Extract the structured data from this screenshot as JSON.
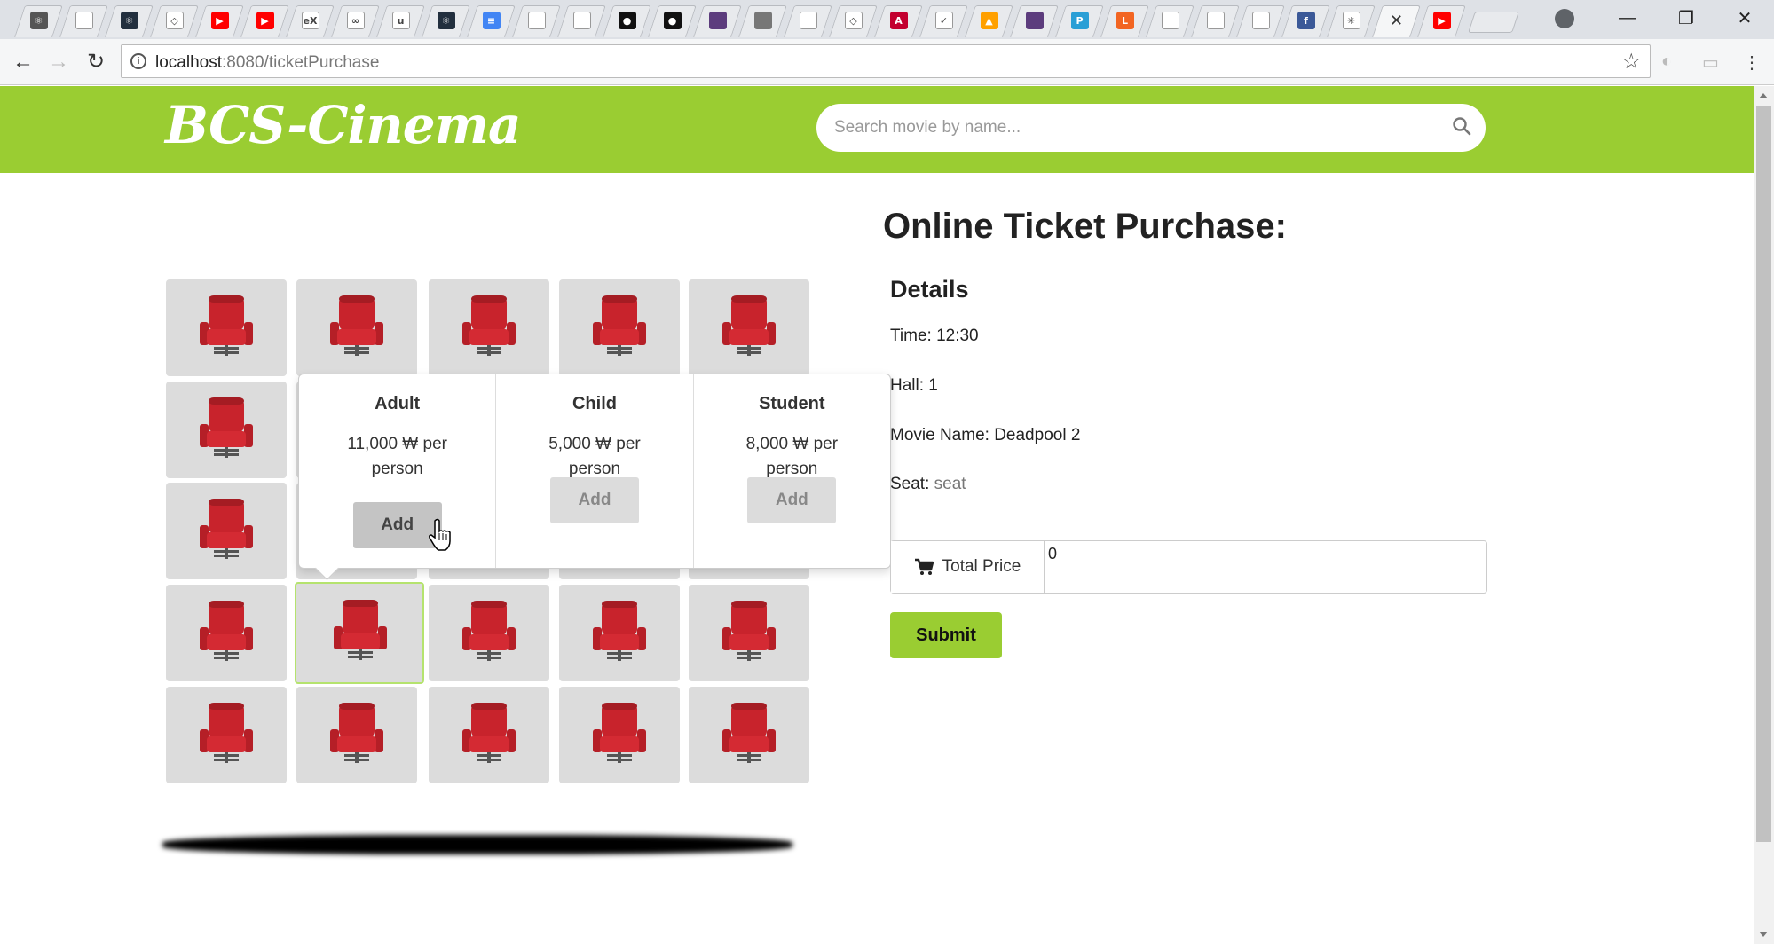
{
  "browser": {
    "tabs": [
      {
        "icon": "atom-icon",
        "color": "#555555",
        "glyph": "⚛"
      },
      {
        "icon": "page-icon",
        "color": "#ffffff",
        "glyph": ""
      },
      {
        "icon": "react-icon",
        "color": "#222f3e",
        "glyph": "⚛"
      },
      {
        "icon": "codepen-icon",
        "color": "#ffffff",
        "glyph": "◇"
      },
      {
        "icon": "youtube-icon",
        "color": "#ff0000",
        "glyph": "▶"
      },
      {
        "icon": "youtube-icon",
        "color": "#ff0000",
        "glyph": "▶"
      },
      {
        "icon": "edx-icon",
        "color": "#ffffff",
        "glyph": "eX"
      },
      {
        "icon": "infinity-icon",
        "color": "#ffffff",
        "glyph": "∞"
      },
      {
        "icon": "udemy-icon",
        "color": "#ffffff",
        "glyph": "u"
      },
      {
        "icon": "react-icon",
        "color": "#222f3e",
        "glyph": "⚛"
      },
      {
        "icon": "docs-icon",
        "color": "#4285f4",
        "glyph": "≡"
      },
      {
        "icon": "page-icon",
        "color": "#ffffff",
        "glyph": ""
      },
      {
        "icon": "page-icon",
        "color": "#ffffff",
        "glyph": ""
      },
      {
        "icon": "github-icon",
        "color": "#111111",
        "glyph": "●"
      },
      {
        "icon": "github-icon",
        "color": "#111111",
        "glyph": "●"
      },
      {
        "icon": "colorlib-icon",
        "color": "#5c3c7d",
        "glyph": ""
      },
      {
        "icon": "colorlib-icon",
        "color": "#777777",
        "glyph": ""
      },
      {
        "icon": "page-icon",
        "color": "#ffffff",
        "glyph": ""
      },
      {
        "icon": "codepen-icon",
        "color": "#ffffff",
        "glyph": "◇"
      },
      {
        "icon": "angular-icon",
        "color": "#c3002f",
        "glyph": "A"
      },
      {
        "icon": "jquery-icon",
        "color": "#ffffff",
        "glyph": "✓"
      },
      {
        "icon": "firebase-icon",
        "color": "#ffa000",
        "glyph": "▲"
      },
      {
        "icon": "colorlib-icon",
        "color": "#5c3c7d",
        "glyph": ""
      },
      {
        "icon": "p-icon",
        "color": "#2a9fd6",
        "glyph": "P"
      },
      {
        "icon": "l-icon",
        "color": "#f26522",
        "glyph": "L"
      },
      {
        "icon": "page-icon",
        "color": "#ffffff",
        "glyph": ""
      },
      {
        "icon": "page-icon",
        "color": "#ffffff",
        "glyph": ""
      },
      {
        "icon": "page-icon",
        "color": "#ffffff",
        "glyph": ""
      },
      {
        "icon": "facebook-icon",
        "color": "#3b5998",
        "glyph": "f"
      },
      {
        "icon": "loading-icon",
        "color": "#ffffff",
        "glyph": "✳"
      },
      {
        "icon": "close-icon",
        "color": "",
        "glyph": "✕",
        "active": true
      },
      {
        "icon": "youtube-icon",
        "color": "#ff0000",
        "glyph": "▶"
      }
    ],
    "url_host": "localhost",
    "url_rest": ":8080/ticketPurchase"
  },
  "header": {
    "logo": "BCS-Cinema",
    "search_placeholder": "Search movie by name..."
  },
  "seats": {
    "rows": 5,
    "cols": 5,
    "selected": {
      "row": 3,
      "col": 1
    }
  },
  "popover": {
    "types": [
      {
        "name": "Adult",
        "price": "11,000 ₩ per person",
        "add": "Add",
        "hover": true
      },
      {
        "name": "Child",
        "price": "5,000 ₩ per person",
        "add": "Add",
        "hover": false
      },
      {
        "name": "Student",
        "price": "8,000 ₩ per person",
        "add": "Add",
        "hover": false
      }
    ]
  },
  "purchase": {
    "title": "Online Ticket Purchase:",
    "details_heading": "Details",
    "time_label": "Time: ",
    "time": "12:30",
    "hall_label": "Hall: ",
    "hall": "1",
    "movie_label": "Movie Name: ",
    "movie": "Deadpool 2",
    "seat_label": "Seat: ",
    "seat": "seat",
    "total_label": "Total Price",
    "total_value": "0",
    "submit": "Submit"
  },
  "colors": {
    "brand": "#9acd32",
    "seat_red": "#c8232c"
  }
}
